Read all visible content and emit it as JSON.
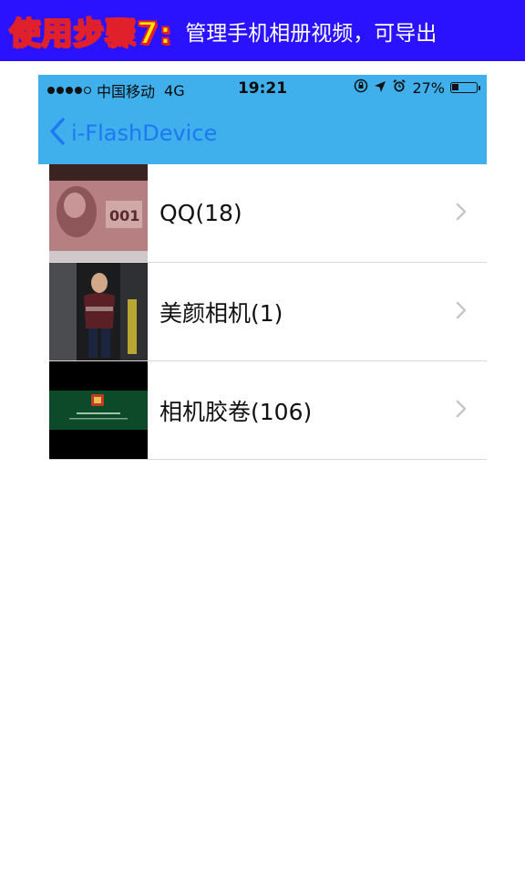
{
  "banner": {
    "step": "使用步骤7:",
    "description": "管理手机相册视频，可导出",
    "background": "#2a12ff"
  },
  "statusbar": {
    "carrier": "中国移动",
    "network": "4G",
    "time": "19:21",
    "battery_percent": "27%",
    "battery_level": 0.27,
    "signal_bars_filled": 4,
    "icons": [
      "orientation-lock-icon",
      "location-arrow-icon",
      "alarm-icon",
      "battery-icon"
    ]
  },
  "navbar": {
    "back_label": "i-FlashDevice",
    "accent": "#1d78f2",
    "background": "#3fb0ec"
  },
  "albums": [
    {
      "title": "QQ(18)",
      "thumbnail": "banknote-photo"
    },
    {
      "title": "美颜相机(1)",
      "thumbnail": "person-photo"
    },
    {
      "title": "相机胶卷(106)",
      "thumbnail": "green-screen-photo"
    }
  ]
}
